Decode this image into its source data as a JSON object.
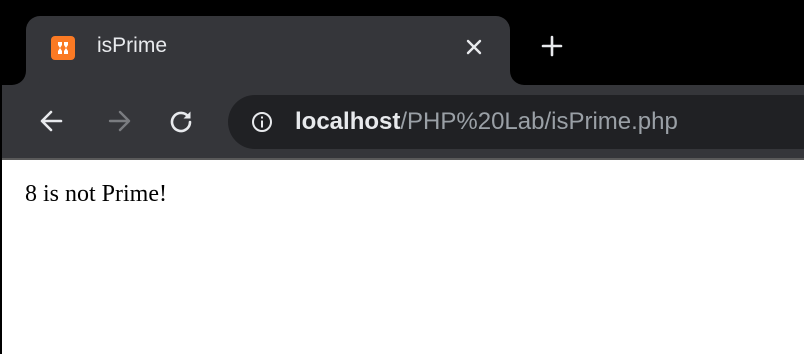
{
  "tab": {
    "title": "isPrime",
    "favicon": "xampp-favicon-icon"
  },
  "toolbar": {
    "url_host": "localhost",
    "url_path": "/PHP%20Lab/isPrime.php"
  },
  "page": {
    "text": "8 is not Prime!"
  },
  "colors": {
    "tabstrip": "#000000",
    "toolbar": "#35363a",
    "omnibox": "#202124",
    "favicon": "#fb7a24"
  }
}
